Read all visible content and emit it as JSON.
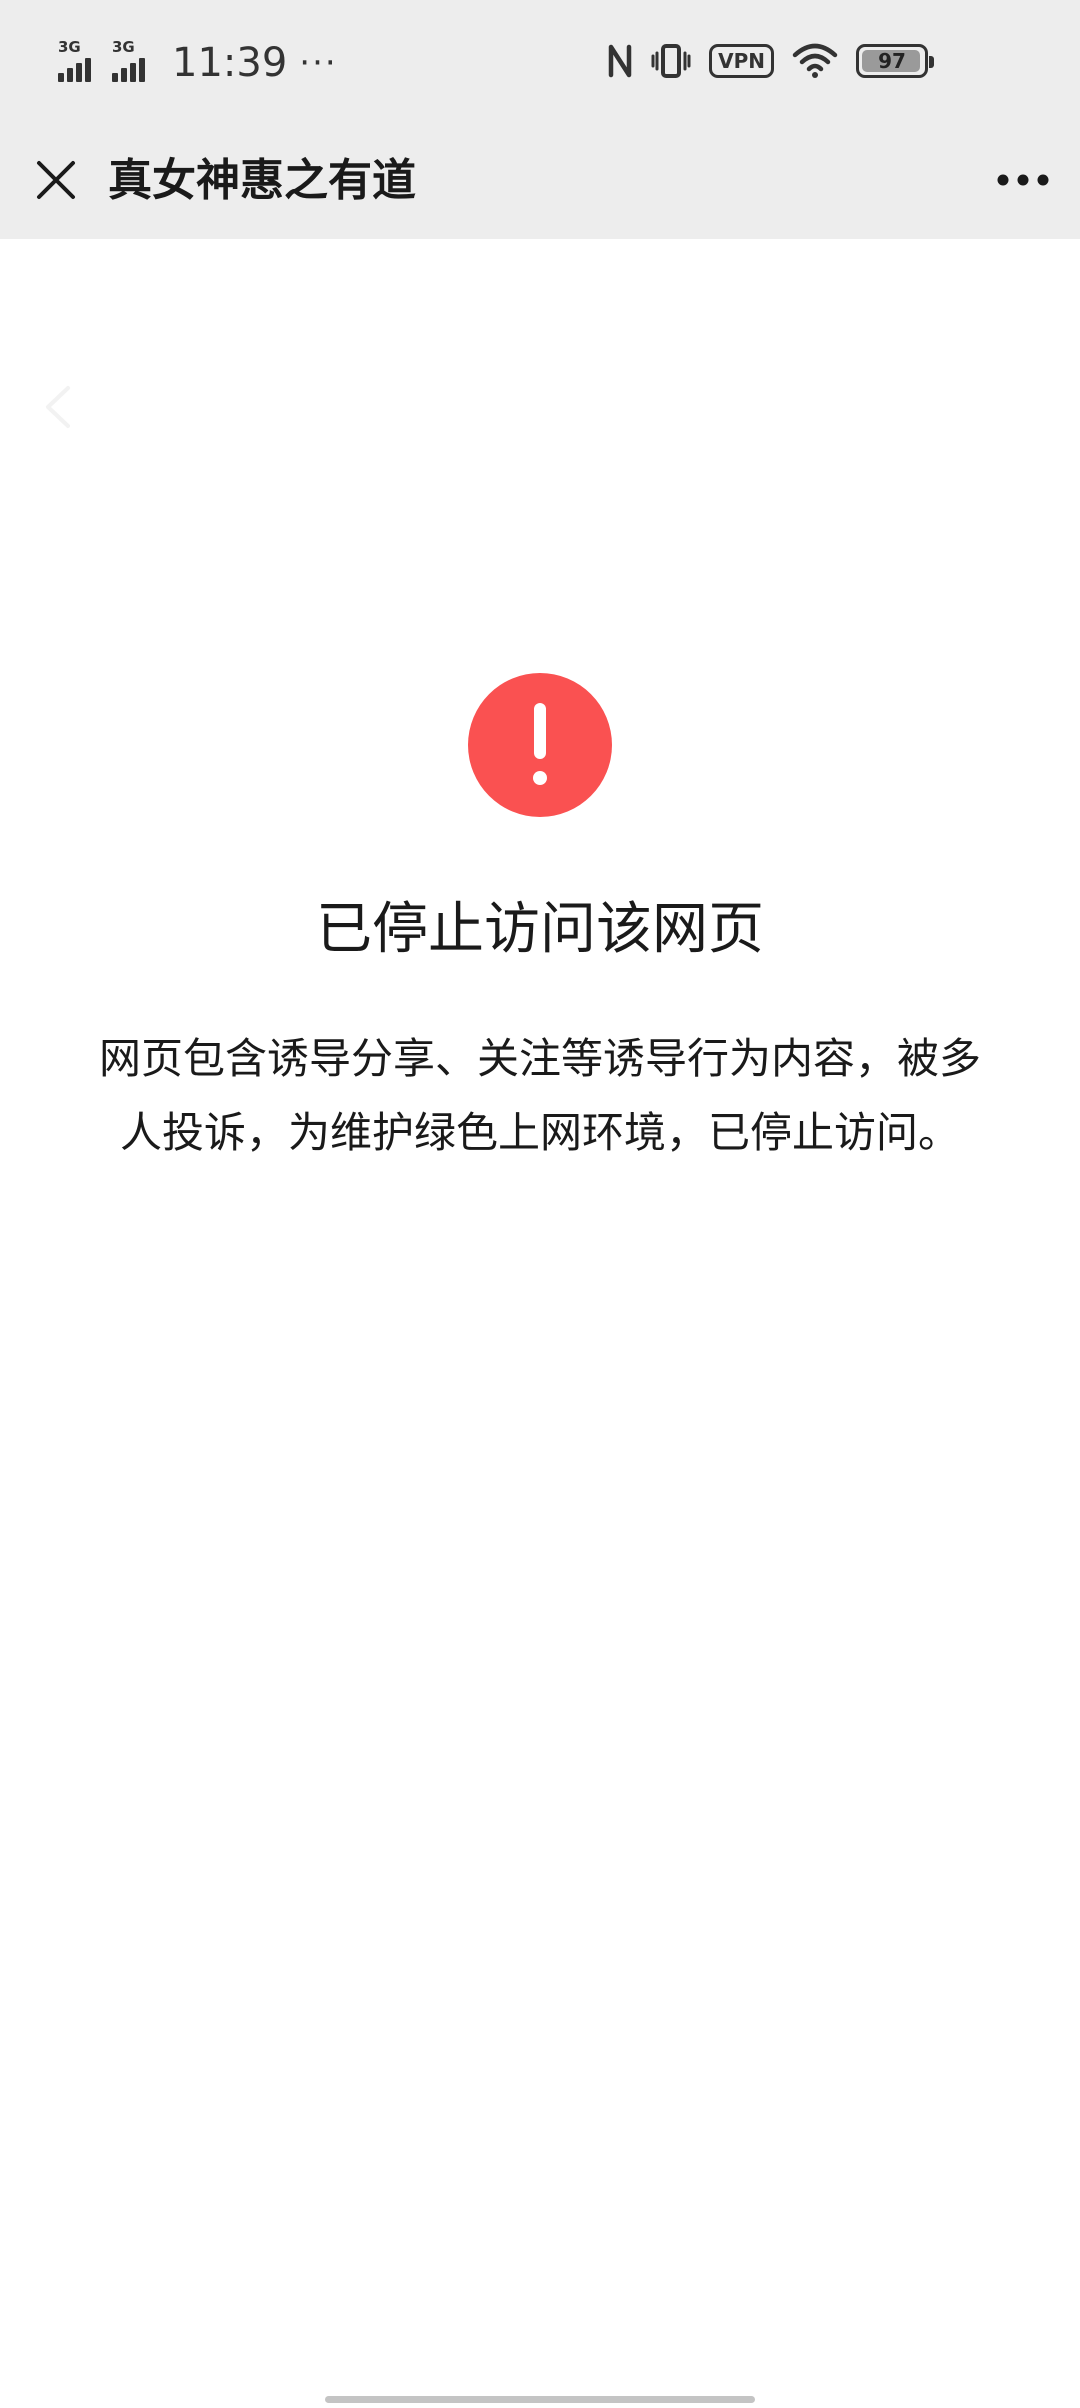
{
  "status_bar": {
    "network_1": "3G",
    "network_2": "3G",
    "time": "11:39",
    "more": "···",
    "vpn": "VPN",
    "battery_level": "97",
    "battery_fraction": 0.97
  },
  "header": {
    "title": "真女神惠之有道",
    "close_icon": "close-icon",
    "more_icon": "more-icon"
  },
  "content": {
    "alert_icon": "warning-icon",
    "alert_color": "#fa5151",
    "title": "已停止访问该网页",
    "message": "网页包含诱导分享、关注等诱导行为内容，被多人投诉，为维护绿色上网环境，已停止访问。"
  }
}
